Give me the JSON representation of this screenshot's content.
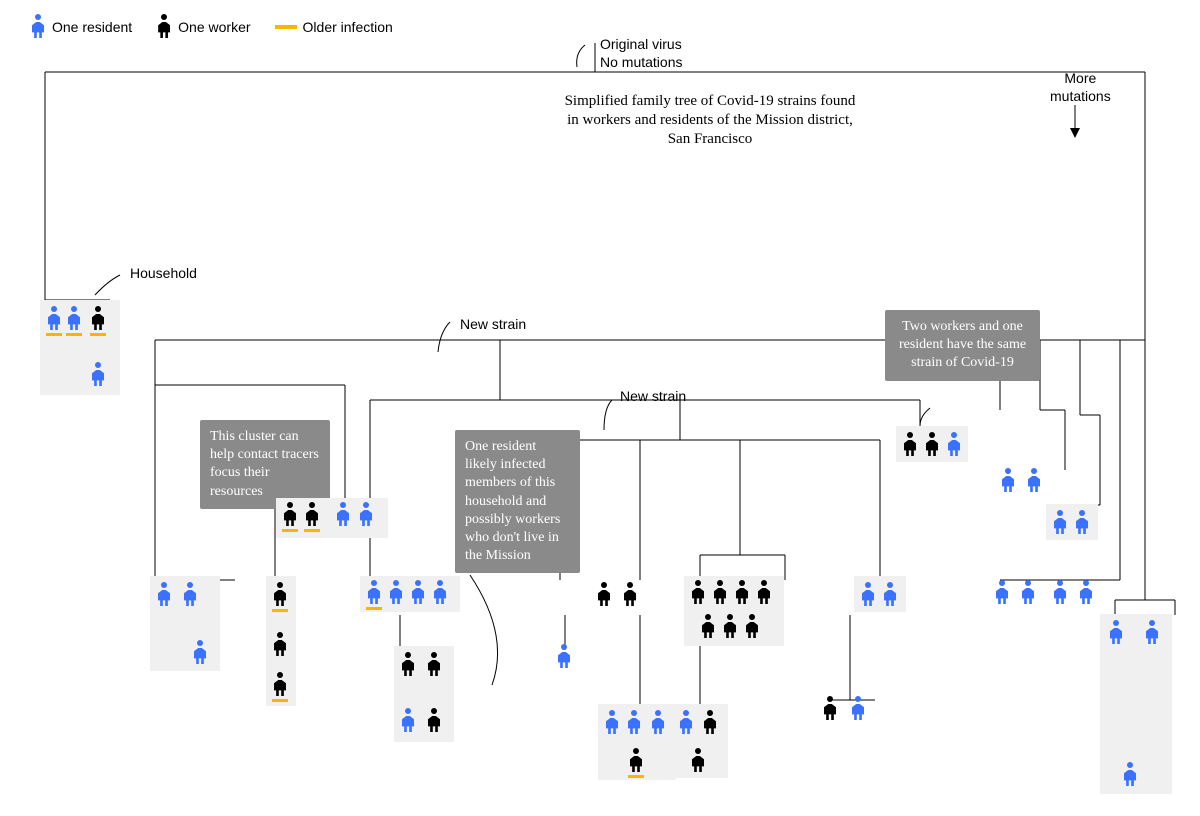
{
  "legend": {
    "resident": "One resident",
    "worker": "One worker",
    "older": "Older infection"
  },
  "labels": {
    "original": "Original virus\nNo mutations",
    "description": "Simplified family tree of Covid-19 strains found in workers and residents of the Mission district, San Francisco",
    "more_mutations": "More\nmutations",
    "household": "Household",
    "new_strain_1": "New strain",
    "new_strain_2": "New strain"
  },
  "callouts": {
    "cluster": "This cluster can help contact tracers focus their resources",
    "household_infect": "One resident likely infected members of this household and possibly workers who don't live in the Mission",
    "two_workers": "Two workers and one resident have the same strain of Covid-19"
  },
  "colors": {
    "resident": "#3a72ff",
    "worker": "#000000",
    "older": "#ffb300",
    "household_box": "#f0f0f0",
    "callout": "#8a8a8a"
  },
  "chart_data": {
    "type": "tree",
    "description": "Phylogenetic tree of Covid-19 strains; each leaf is a group of individuals (residents=blue, workers=black). Leaves with a household box share a strain. 'older' = yellow underline indicating older infection.",
    "root": "Original virus, no mutations",
    "y_axis": "More mutations (downward)",
    "leaves": [
      {
        "id": "A",
        "household": true,
        "label": "Household",
        "people": [
          {
            "t": "res",
            "older": true
          },
          {
            "t": "res",
            "older": true
          },
          {
            "t": "wrk",
            "older": true
          },
          {
            "t": "res"
          }
        ]
      },
      {
        "id": "B",
        "household": true,
        "callout": "cluster",
        "people": [
          {
            "t": "wrk",
            "older": true
          },
          {
            "t": "wrk",
            "older": true
          },
          {
            "t": "res"
          },
          {
            "t": "res"
          }
        ]
      },
      {
        "id": "C",
        "household": true,
        "people": [
          {
            "t": "res"
          },
          {
            "t": "res"
          },
          {
            "t": "res"
          }
        ]
      },
      {
        "id": "D",
        "household": true,
        "people": [
          {
            "t": "wrk",
            "older": true
          },
          {
            "t": "wrk"
          },
          {
            "t": "wrk",
            "older": true
          }
        ]
      },
      {
        "id": "E",
        "household": true,
        "callout": "household_infect",
        "people": [
          {
            "t": "res",
            "older": true
          },
          {
            "t": "res"
          },
          {
            "t": "res"
          },
          {
            "t": "res"
          }
        ]
      },
      {
        "id": "F",
        "household": true,
        "people": [
          {
            "t": "wrk"
          },
          {
            "t": "wrk"
          },
          {
            "t": "res"
          },
          {
            "t": "wrk"
          }
        ]
      },
      {
        "id": "G",
        "household": false,
        "people": [
          {
            "t": "wrk"
          },
          {
            "t": "wrk"
          }
        ]
      },
      {
        "id": "H",
        "household": true,
        "people": [
          {
            "t": "res"
          },
          {
            "t": "res"
          },
          {
            "t": "res"
          },
          {
            "t": "wrk",
            "older": true
          }
        ]
      },
      {
        "id": "I",
        "household": false,
        "people": [
          {
            "t": "res"
          }
        ]
      },
      {
        "id": "J",
        "household": true,
        "people": [
          {
            "t": "wrk"
          },
          {
            "t": "wrk"
          },
          {
            "t": "wrk"
          },
          {
            "t": "wrk"
          },
          {
            "t": "wrk"
          },
          {
            "t": "wrk"
          },
          {
            "t": "wrk"
          }
        ]
      },
      {
        "id": "K",
        "household": true,
        "people": [
          {
            "t": "res"
          },
          {
            "t": "wrk"
          }
        ]
      },
      {
        "id": "L",
        "household": false,
        "people": [
          {
            "t": "wrk"
          },
          {
            "t": "res"
          }
        ]
      },
      {
        "id": "M",
        "household": true,
        "people": [
          {
            "t": "res"
          },
          {
            "t": "res"
          }
        ]
      },
      {
        "id": "N",
        "household": true,
        "callout": "two_workers",
        "people": [
          {
            "t": "wrk"
          },
          {
            "t": "wrk"
          },
          {
            "t": "res"
          }
        ]
      },
      {
        "id": "O",
        "household": false,
        "people": [
          {
            "t": "res"
          },
          {
            "t": "res"
          }
        ]
      },
      {
        "id": "P",
        "household": true,
        "people": [
          {
            "t": "res"
          },
          {
            "t": "res"
          }
        ]
      },
      {
        "id": "Q",
        "household": false,
        "people": [
          {
            "t": "res"
          },
          {
            "t": "res"
          },
          {
            "t": "res"
          },
          {
            "t": "res"
          }
        ]
      },
      {
        "id": "R",
        "household": true,
        "people": [
          {
            "t": "res"
          },
          {
            "t": "res"
          },
          {
            "t": "res"
          }
        ]
      }
    ]
  }
}
